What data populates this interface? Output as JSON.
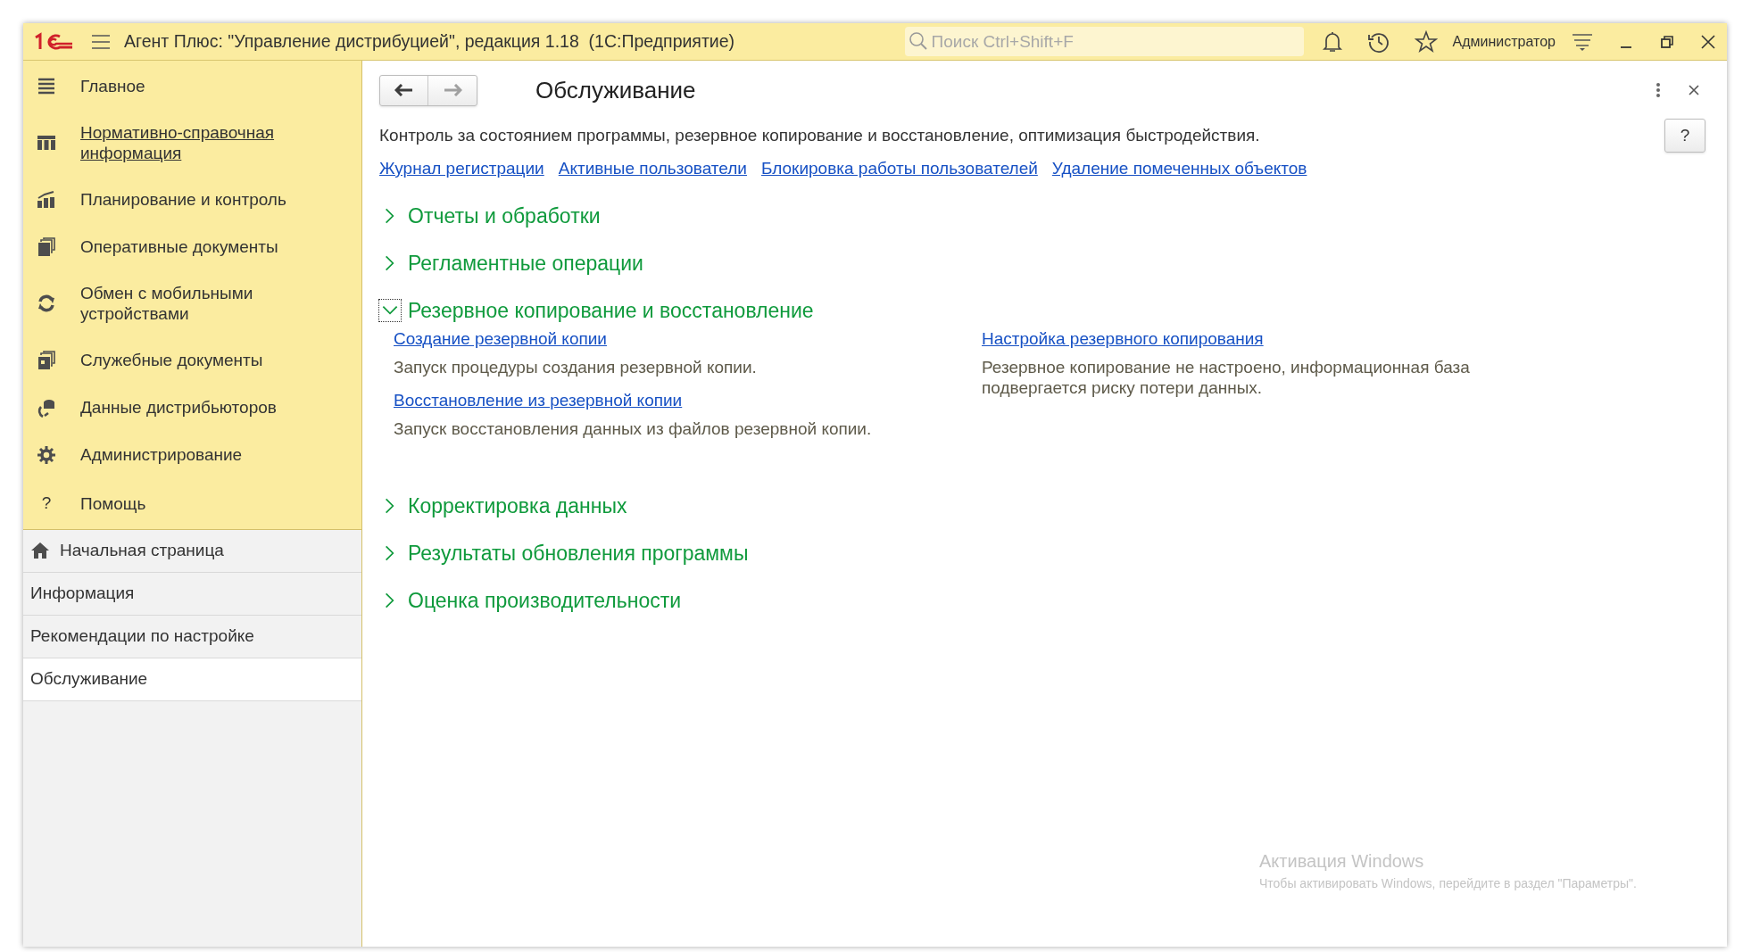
{
  "window": {
    "title": "Агент Плюс: \"Управление дистрибуцией\", редакция 1.18  (1С:Предприятие)",
    "search": {
      "placeholder": "Поиск Ctrl+Shift+F"
    },
    "user": "Администратор"
  },
  "sidebar": {
    "sections": [
      {
        "label": "Главное",
        "hovered": false
      },
      {
        "label": "Нормативно-справочная информация",
        "hovered": true
      },
      {
        "label": "Планирование и контроль",
        "hovered": false
      },
      {
        "label": "Оперативные документы",
        "hovered": false
      },
      {
        "label": "Обмен с мобильными устройствами",
        "hovered": false
      },
      {
        "label": "Служебные документы",
        "hovered": false
      },
      {
        "label": "Данные дистрибьюторов",
        "hovered": false
      },
      {
        "label": "Администрирование",
        "hovered": false
      },
      {
        "label": "Помощь",
        "hovered": false,
        "icon_text": "?"
      }
    ],
    "nav_items": [
      {
        "label": "Начальная страница",
        "kind": "home",
        "selected": false
      },
      {
        "label": "Информация",
        "kind": "text",
        "selected": false
      },
      {
        "label": "Рекомендации по настройке",
        "kind": "text",
        "selected": false
      },
      {
        "label": "Обслуживание",
        "kind": "text",
        "selected": true
      }
    ]
  },
  "page": {
    "title": "Обслуживание",
    "help_button": "?",
    "back": {
      "disabled": false
    },
    "forward": {
      "disabled": true
    },
    "description": "Контроль за состоянием программы, резервное копирование и восстановление, оптимизация быстродействия.",
    "links": [
      "Журнал регистрации",
      "Активные пользователи",
      "Блокировка работы пользователей",
      "Удаление помеченных объектов"
    ],
    "sections": [
      {
        "title": "Отчеты и обработки",
        "expanded": false,
        "focused": false
      },
      {
        "title": "Регламентные операции",
        "expanded": false,
        "focused": false
      },
      {
        "title": "Резервное копирование и восстановление",
        "expanded": true,
        "focused": true,
        "columns": [
          [
            {
              "link": "Создание резервной копии",
              "text": "Запуск процедуры создания резервной копии."
            },
            {
              "link": "Восстановление из резервной копии",
              "text": "Запуск восстановления данных из файлов резервной копии."
            }
          ],
          [
            {
              "link": "Настройка резервного копирования",
              "text": "Резервное копирование не настроено, информационная база подвергается риску потери данных."
            }
          ]
        ]
      },
      {
        "title": "Корректировка данных",
        "expanded": false,
        "focused": false
      },
      {
        "title": "Результаты обновления программы",
        "expanded": false,
        "focused": false
      },
      {
        "title": "Оценка производительности",
        "expanded": false,
        "focused": false
      }
    ]
  },
  "windows_activation": {
    "title": "Активация Windows",
    "text": "Чтобы активировать Windows, перейдите в раздел \"Параметры\"."
  }
}
